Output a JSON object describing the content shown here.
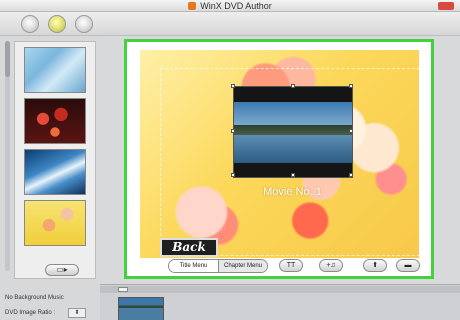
{
  "window": {
    "title": "WinX DVD Author"
  },
  "toolbar_top": {
    "buttons": [
      "round-button-1",
      "round-button-2",
      "round-button-3"
    ]
  },
  "sidebar": {
    "thumbnails": [
      {
        "name": "background-light-blue"
      },
      {
        "name": "background-red-flowers"
      },
      {
        "name": "background-blue-abstract"
      },
      {
        "name": "background-yellow-flowers"
      }
    ],
    "add_button_label": "▭▸",
    "background_music": "No Background Music",
    "image_ratio_label": "DVD Image Ratio :"
  },
  "menu": {
    "movie_title": "Movie No. 1",
    "back_label": "Back"
  },
  "menu_toolbar": {
    "tabs": [
      "Title Menu",
      "Chapter Menu"
    ],
    "text_button": "TT",
    "music_button": "+♫",
    "up_button": "⬆",
    "minus_button": "▬"
  },
  "colors": {
    "selection_border": "#44d13e"
  }
}
